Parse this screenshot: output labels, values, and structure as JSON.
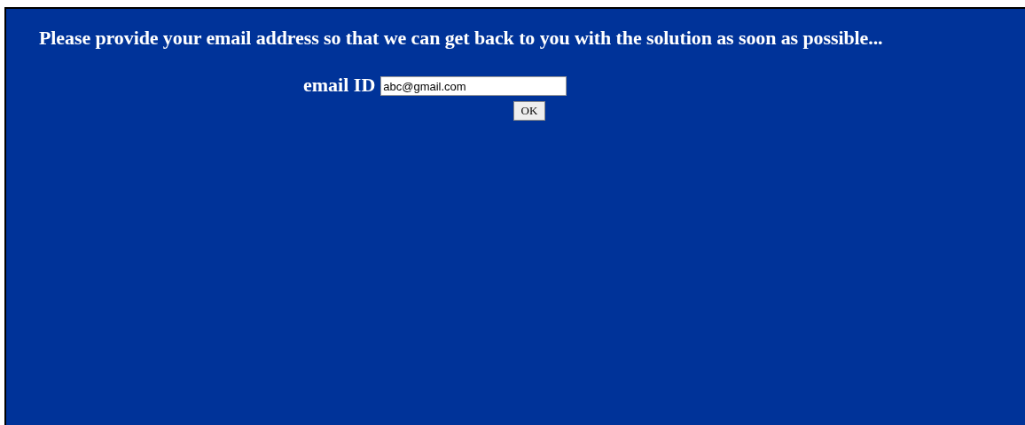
{
  "heading": "Please provide your email address so that we can get back to you with the solution as soon as possible...",
  "email_field": {
    "label": "email ID",
    "value": "abc@gmail.com"
  },
  "buttons": [
    "OK"
  ]
}
